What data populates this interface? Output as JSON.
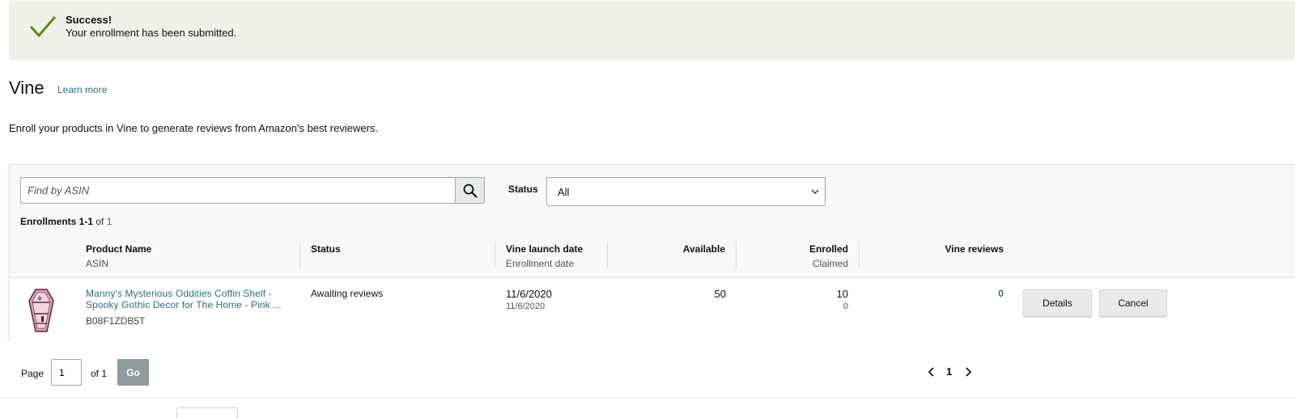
{
  "alert": {
    "title": "Success!",
    "message": "Your enrollment has been submitted.",
    "icon": "check-icon",
    "color": "#5a8c1e"
  },
  "header": {
    "title": "Vine",
    "learn_more": "Learn more",
    "intro": "Enroll your products in Vine to generate reviews from Amazon's best reviewers."
  },
  "filters": {
    "search_placeholder": "Find by ASIN",
    "search_icon": "search-icon",
    "status_label": "Status",
    "status_value": "All"
  },
  "count": {
    "prefix": "Enrollments 1-1",
    "of": "of",
    "total": "1"
  },
  "columns": {
    "product_name": "Product Name",
    "asin": "ASIN",
    "status": "Status",
    "vine_launch_date": "Vine launch date",
    "enrollment_date": "Enrollment date",
    "available": "Available",
    "enrolled": "Enrolled",
    "claimed": "Claimed",
    "vine_reviews": "Vine reviews"
  },
  "rows": [
    {
      "product_name": "Manny's Mysterious Oddities Coffin Shelf - Spooky Gothic Decor for The Home - Pink ...",
      "asin": "B08F1ZDB5T",
      "status": "Awaiting reviews",
      "vine_launch_date": "11/6/2020",
      "enrollment_date": "11/6/2020",
      "available": "50",
      "enrolled": "10",
      "claimed": "0",
      "vine_reviews": "0",
      "details_label": "Details",
      "cancel_label": "Cancel"
    }
  ],
  "pagination": {
    "page_label": "Page",
    "page_value": "1",
    "of_label": "of 1",
    "go_label": "Go",
    "current": "1"
  },
  "colors": {
    "link": "#2d6e86",
    "alert_bg": "#eff1e9",
    "go_button": "#8f9b9c"
  }
}
